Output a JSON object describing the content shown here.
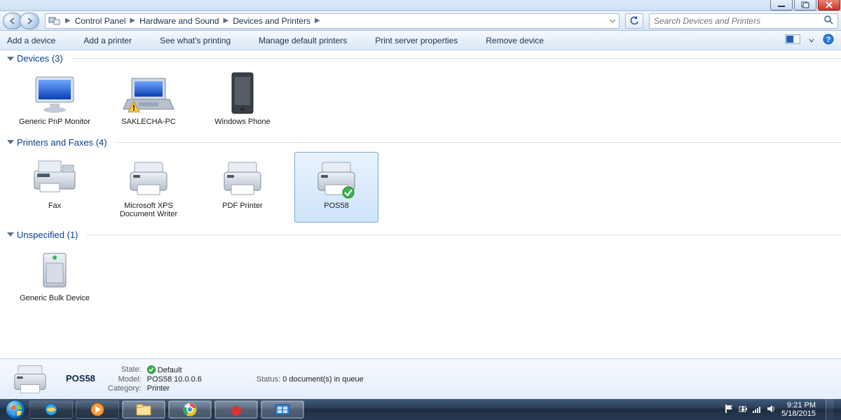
{
  "breadcrumb": {
    "p1": "Control Panel",
    "p2": "Hardware and Sound",
    "p3": "Devices and Printers"
  },
  "search": {
    "placeholder": "Search Devices and Printers"
  },
  "commands": {
    "add_device": "Add a device",
    "add_printer": "Add a printer",
    "see_printing": "See what's printing",
    "manage_default": "Manage default printers",
    "server_props": "Print server properties",
    "remove": "Remove device"
  },
  "groups": {
    "devices": {
      "header": "Devices (3)",
      "items": [
        {
          "label": "Generic PnP Monitor"
        },
        {
          "label": "SAKLECHA-PC"
        },
        {
          "label": "Windows Phone"
        }
      ]
    },
    "printers": {
      "header": "Printers and Faxes (4)",
      "items": [
        {
          "label": "Fax"
        },
        {
          "label": "Microsoft XPS Document Writer"
        },
        {
          "label": "PDF Printer"
        },
        {
          "label": "POS58"
        }
      ]
    },
    "unspecified": {
      "header": "Unspecified (1)",
      "items": [
        {
          "label": "Generic Bulk Device"
        }
      ]
    }
  },
  "details": {
    "title": "POS58",
    "state_label": "State:",
    "state_value": "Default",
    "model_label": "Model:",
    "model_value": "POS58 10.0.0.6",
    "category_label": "Category:",
    "category_value": "Printer",
    "status_label": "Status:",
    "status_value": "0 document(s) in queue"
  },
  "tray": {
    "time": "9:21 PM",
    "date": "5/18/2015"
  }
}
